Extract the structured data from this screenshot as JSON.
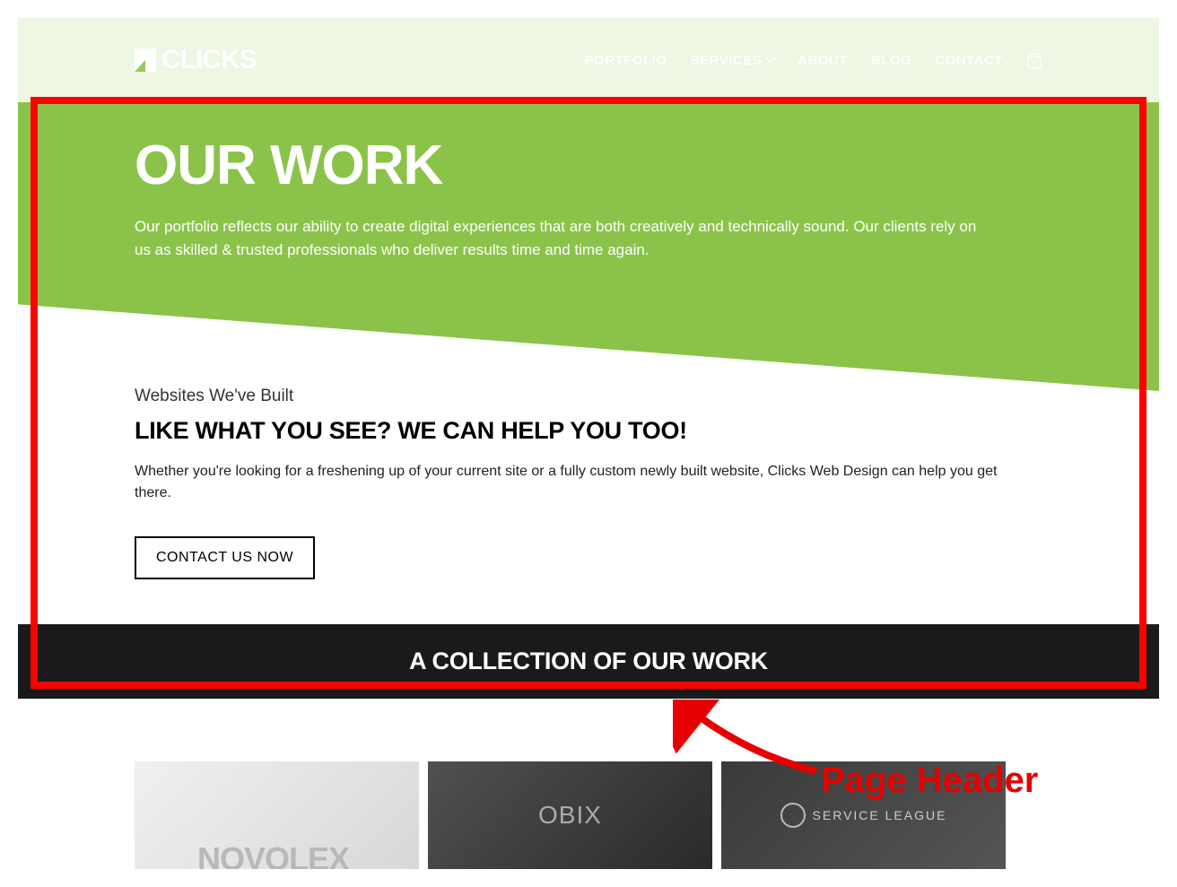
{
  "brand": "CLICKS",
  "nav": {
    "items": [
      {
        "label": "PORTFOLIO"
      },
      {
        "label": "SERVICES"
      },
      {
        "label": "ABOUT"
      },
      {
        "label": "BLOG"
      },
      {
        "label": "CONTACT"
      }
    ]
  },
  "hero": {
    "title": "OUR WORK",
    "body": "Our portfolio reflects our ability to create digital experiences that are both creatively and technically sound. Our clients rely on us as skilled & trusted professionals who deliver results time and time again."
  },
  "intro": {
    "sub": "Websites We've Built",
    "heading": "LIKE WHAT YOU SEE? WE CAN HELP YOU TOO!",
    "body": "Whether you're looking for a freshening up of your current site or a fully custom newly built website, Clicks Web Design can help you get there.",
    "cta": "CONTACT US NOW"
  },
  "collection_title": "A COLLECTION OF OUR WORK",
  "portfolio": {
    "items": [
      {
        "label": "NOVOLEX"
      },
      {
        "label": "OBIX"
      },
      {
        "label": "SERVICE LEAGUE"
      }
    ]
  },
  "annotation": "Page Header",
  "colors": {
    "accent": "#8bc34a",
    "dark": "#1a1a1a",
    "annotation": "#e60000"
  }
}
